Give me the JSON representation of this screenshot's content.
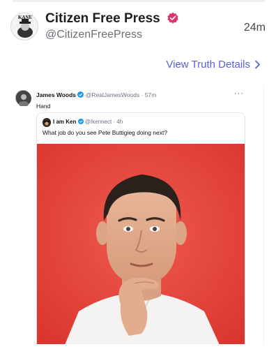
{
  "post": {
    "display_name": "Citizen Free Press",
    "handle": "@CitizenFreePress",
    "timestamp": "24m",
    "avatar_label": "KANE",
    "verified_color": "#e1306c"
  },
  "actions": {
    "view_truth_details": "View Truth Details"
  },
  "quoted_tweet": {
    "author": "James Woods",
    "handle_time": "@RealJamesWoods · 57m",
    "text": "Hand",
    "more": "···",
    "inner": {
      "author": "I am Ken",
      "handle_time": "@Ikennect · 4h",
      "text": "What job do you see Pete Buttigieg doing next?",
      "image_background": "#e54a43"
    }
  },
  "colors": {
    "accent": "#5c5fd1",
    "twitter_verified": "#1d9bf0"
  }
}
